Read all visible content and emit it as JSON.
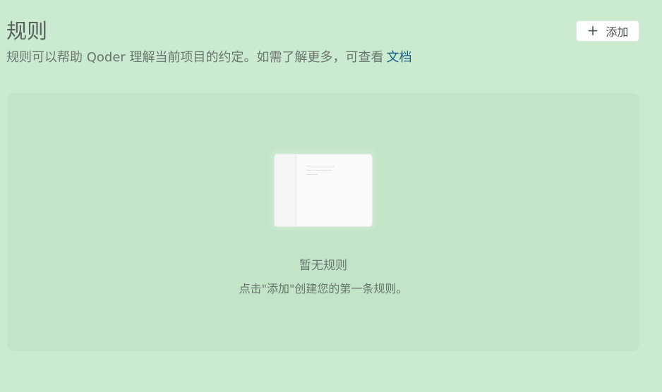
{
  "header": {
    "title": "规则",
    "subtitle": "规则可以帮助 Qoder 理解当前项目的约定。如需了解更多，可查看",
    "doc_link": "文档",
    "add_label": "添加",
    "add_icon": "plus-icon"
  },
  "empty_state": {
    "illustration_icon": "document-icon",
    "title": "暂无规则",
    "description": "点击\"添加\"创建您的第一条规则。"
  },
  "colors": {
    "background": "#caebd0",
    "panel": "#c2e5c8",
    "link": "#1b5e8a"
  }
}
